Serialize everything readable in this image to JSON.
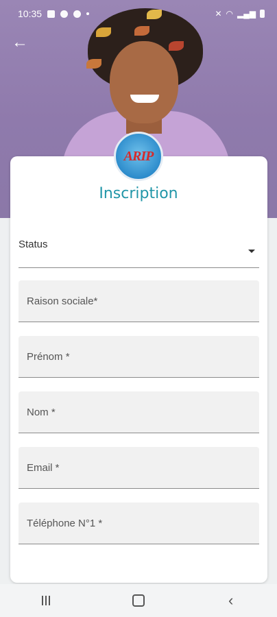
{
  "status_bar": {
    "time": "10:35"
  },
  "header": {
    "back_icon": "arrow-left-icon",
    "logo_text": "ARIP"
  },
  "form": {
    "title": "Inscription",
    "status_label": "Status",
    "fields": {
      "raison_sociale": "Raison sociale*",
      "prenom": "Prénom *",
      "nom": "Nom *",
      "email": "Email *",
      "telephone": "Téléphone N°1 *"
    }
  },
  "colors": {
    "accent": "#2196a8",
    "header_bg": "#9a86b5"
  }
}
